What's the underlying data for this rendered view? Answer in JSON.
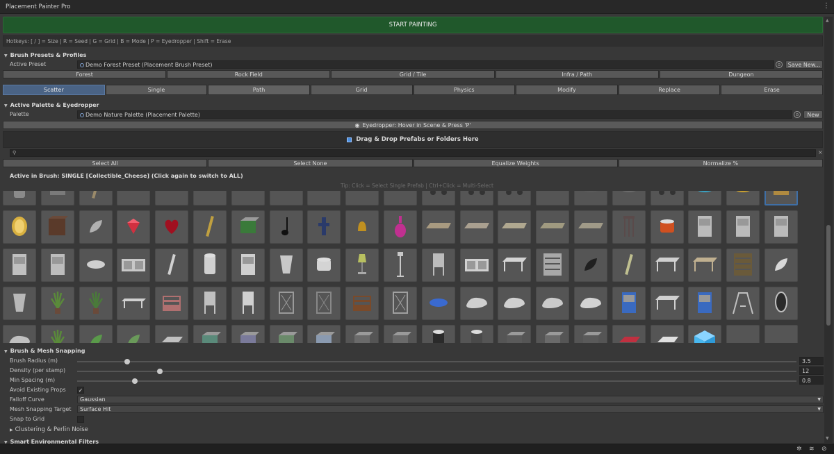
{
  "window": {
    "title": "Placement Painter Pro",
    "menu_icon": "kebab-menu-icon"
  },
  "start_button": "START PAINTING",
  "hotkeys": "Hotkeys: [ / ] = Size  |  R = Seed  |  G = Grid  |  B = Mode  |  P = Eyedropper  |  Shift = Erase",
  "presets": {
    "header": "Brush Presets & Profiles",
    "active_label": "Active Preset",
    "active_value": "Demo Forest Preset (Placement Brush Preset)",
    "save_label": "Save New...",
    "profiles": [
      "Forest",
      "Rock Field",
      "Grid / Tile",
      "Infra / Path",
      "Dungeon"
    ],
    "modes": [
      "Scatter",
      "Single",
      "Path",
      "Grid",
      "Physics",
      "Modify",
      "Replace",
      "Erase"
    ],
    "active_mode": "Scatter"
  },
  "palette": {
    "header": "Active Palette & Eyedropper",
    "palette_label": "Palette",
    "palette_value": "Demo Nature Palette (Placement Palette)",
    "new_label": "New",
    "eyedropper_label": "Eyedropper: Hover in Scene & Press 'P'",
    "dropzone_label": "Drag & Drop Prefabs or Folders Here",
    "search_placeholder": "",
    "actions": [
      "Select All",
      "Select None",
      "Equalize Weights",
      "Normalize %"
    ],
    "active_in_brush": "Active in Brush: SINGLE [Collectible_Cheese] (Click again to switch to ALL)",
    "tip": "Tip: Click = Select Single Prefab  |  Ctrl+Click = Multi-Select"
  },
  "snapping": {
    "header": "Brush & Mesh Snapping",
    "brush_radius_label": "Brush Radius (m)",
    "brush_radius": "3.5",
    "brush_radius_level": 0.07,
    "density_label": "Density (per stamp)",
    "density": "12",
    "density_level": 0.115,
    "min_spacing_label": "Min Spacing (m)",
    "min_spacing": "0.8",
    "min_spacing_level": 0.08,
    "avoid_label": "Avoid Existing Props",
    "avoid_checked": true,
    "falloff_label": "Falloff Curve",
    "falloff_value": "Gaussian",
    "mesh_target_label": "Mesh Snapping Target",
    "mesh_target_value": "Surface Hit",
    "snap_grid_label": "Snap to Grid",
    "snap_grid_checked": false,
    "clustering_label": "Clustering & Perlin Noise",
    "env_filters_label": "Smart Environmental Filters"
  },
  "colors": {
    "start": "#20582b",
    "active_mode": "#4a6385",
    "panel": "#383838",
    "accent_blue": "#4a8fe0"
  }
}
